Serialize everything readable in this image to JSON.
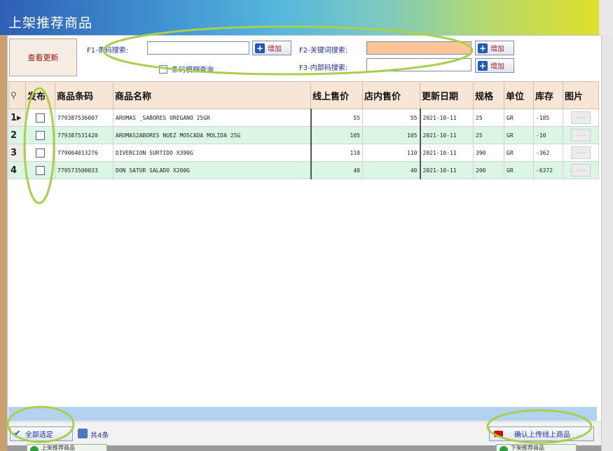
{
  "window": {
    "title": "上架推荐商品"
  },
  "toolbar": {
    "check_update": "查看更新",
    "f1_label": "F1-条码搜索:",
    "f1_value": "",
    "f1_add": "增加",
    "fuzzy_label": "条码模糊查询",
    "f2_label": "F2-关键词搜索:",
    "f2_value": "",
    "f2_add": "增加",
    "f3_label": "F3-内部码搜索:",
    "f3_value": "",
    "f3_add": "增加"
  },
  "grid": {
    "columns": [
      "发布",
      "商品条码",
      "商品名称",
      "线上售价",
      "店内售价",
      "更新日期",
      "规格",
      "单位",
      "库存",
      "图片"
    ],
    "rows": [
      {
        "no": "1",
        "barcode": "779387536007",
        "name": "AROMAS _SABORES OREGANO 25GR",
        "online": "55",
        "store": "55",
        "date": "2021-10-11",
        "spec": "25",
        "unit": "GR",
        "stock": "-185",
        "img": "..."
      },
      {
        "no": "2",
        "barcode": "779387531420",
        "name": "AROMAS2ABORES NUEZ MOSCADA MOLIDA 25G",
        "online": "105",
        "store": "105",
        "date": "2021-10-11",
        "spec": "25",
        "unit": "GR",
        "stock": "-10",
        "img": "..."
      },
      {
        "no": "3",
        "barcode": "779004013276",
        "name": "DIVERCION SURTIDO X390G",
        "online": "110",
        "store": "110",
        "date": "2021-10-11",
        "spec": "390",
        "unit": "GR",
        "stock": "-362",
        "img": "..."
      },
      {
        "no": "4",
        "barcode": "779573500033",
        "name": "DON SATUR SALADO X200G",
        "online": "40",
        "store": "40",
        "date": "2021-10-11",
        "spec": "200",
        "unit": "GR",
        "stock": "-6372",
        "img": "..."
      }
    ]
  },
  "footer": {
    "select_all": "全部选定",
    "count": "共4条",
    "confirm": "确认上传线上商品"
  },
  "behind": {
    "left_button": "上架推荐商品",
    "right_button": "下架推荐商品"
  },
  "colors": {
    "annotation_circle": "#a8d04a",
    "header_bg": "#f7e5d5",
    "alt_row_bg": "#dcf6e5",
    "highlight_input": "#fcc599"
  }
}
